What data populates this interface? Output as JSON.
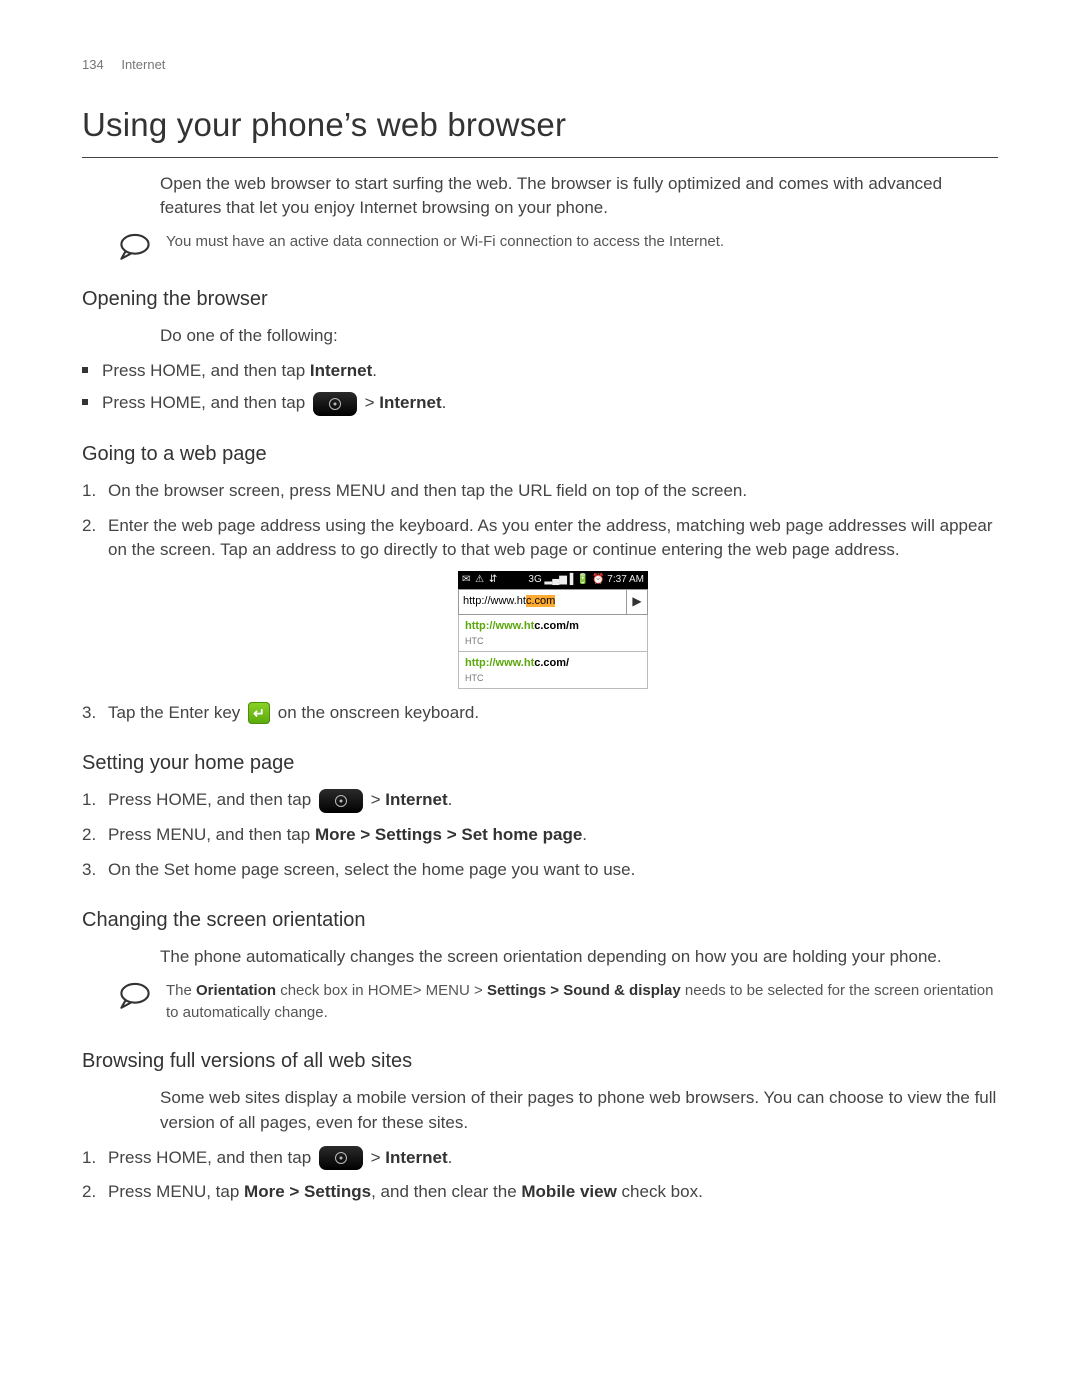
{
  "header": {
    "page_num": "134",
    "section": "Internet"
  },
  "title": "Using your phone’s web browser",
  "intro": "Open the web browser to start surfing the web. The browser is fully optimized and comes with advanced features that let you enjoy Internet browsing on your phone.",
  "note1": "You must have an active data connection or Wi-Fi connection to access the Internet.",
  "s1": {
    "heading": "Opening the browser",
    "lead": "Do one of the following:",
    "li1a": "Press HOME, and then tap ",
    "li1b": "Internet",
    "li1c": ".",
    "li2a": "Press HOME, and then tap ",
    "li2b": "  > ",
    "li2c": "Internet",
    "li2d": "."
  },
  "s2": {
    "heading": "Going to a web page",
    "li1": "On the browser screen, press MENU and then tap the URL field on top of the screen.",
    "li2": "Enter the web page address using the keyboard. As you enter the address, matching web page addresses will appear on the screen. Tap an address to go directly to that web page or continue entering the web page address.",
    "li3a": "Tap the Enter key ",
    "li3b": " on the onscreen keyboard."
  },
  "shot": {
    "status_left": "✉ ⚠ ⇵",
    "status_right": "3G ▂▄▆ ▌🔋 ⏰ 7:37 AM",
    "url_plain": "http://www.ht",
    "url_sel": "c.com",
    "go": "▶",
    "sug1_g": "http://www.ht",
    "sug1_r": "c.com/m",
    "sug1_sub": "HTC",
    "sug2_g": "http://www.ht",
    "sug2_r": "c.com/",
    "sug2_sub": "HTC"
  },
  "s3": {
    "heading": "Setting your home page",
    "li1a": "Press HOME, and then tap ",
    "li1b": "  > ",
    "li1c": "Internet",
    "li1d": ".",
    "li2a": "Press MENU, and then tap ",
    "li2b": "More > Settings > Set home page",
    "li2c": ".",
    "li3": "On the Set home page screen, select the home page you want to use."
  },
  "s4": {
    "heading": "Changing the screen orientation",
    "p": "The phone automatically changes the screen orientation depending on how you are holding your phone."
  },
  "note2a": "The ",
  "note2b": "Orientation",
  "note2c": " check box in HOME> MENU > ",
  "note2d": "Settings > Sound & display",
  "note2e": " needs to be selected for the screen orientation to automatically change.",
  "s5": {
    "heading": "Browsing full versions of all web sites",
    "p": "Some web sites display a mobile version of their pages to phone web browsers. You can choose to view the full version of all pages, even for these sites.",
    "li1a": "Press HOME, and then tap ",
    "li1b": "  > ",
    "li1c": "Internet",
    "li1d": ".",
    "li2a": "Press MENU, tap ",
    "li2b": "More > Settings",
    "li2c": ", and then clear the ",
    "li2d": "Mobile view",
    "li2e": " check box."
  }
}
